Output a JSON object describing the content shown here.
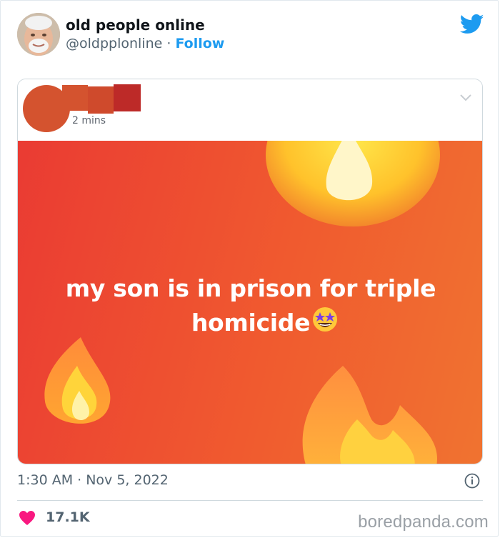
{
  "tweet": {
    "display_name": "old people online",
    "handle": "@oldpplonline",
    "separator": "·",
    "follow_label": "Follow",
    "timestamp": "1:30 AM · Nov 5, 2022",
    "likes": "17.1K"
  },
  "embedded_post": {
    "time_ago": "2 mins",
    "text_line1": "my son is in prison for triple",
    "text_line2": "homicide",
    "emoji": "star-struck-emoji"
  },
  "watermark": "boredpanda.com",
  "colors": {
    "twitter_blue": "#1d9bf0",
    "heart_pink": "#f91880",
    "banner_red": "#ea3b33",
    "banner_orange": "#f07330"
  }
}
